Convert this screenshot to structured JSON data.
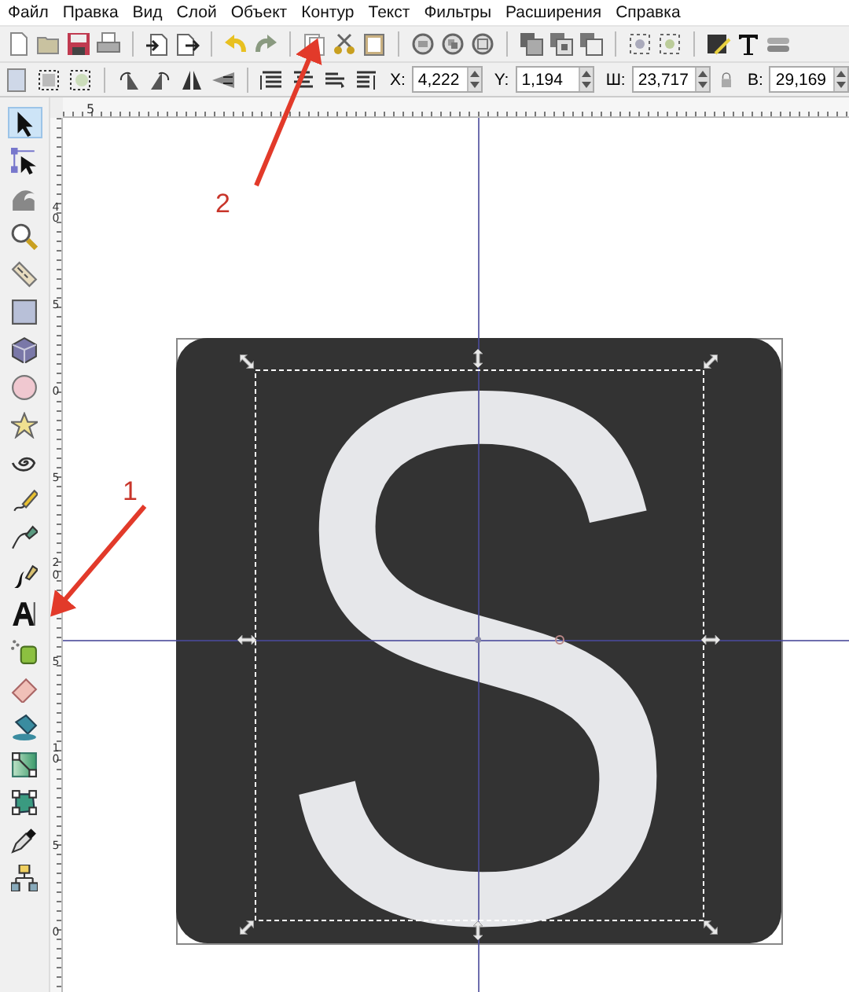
{
  "menu": [
    "Файл",
    "Правка",
    "Вид",
    "Слой",
    "Объект",
    "Контур",
    "Текст",
    "Фильтры",
    "Расширения",
    "Справка"
  ],
  "coordinates": [
    {
      "label": "X:",
      "value": "4,222"
    },
    {
      "label": "Y:",
      "value": "1,194"
    },
    {
      "label": "Ш:",
      "value": "23,717"
    },
    {
      "label": "В:",
      "value": "29,169"
    }
  ],
  "tools": [
    {
      "kind": "select",
      "selected": true
    },
    {
      "kind": "node",
      "selected": false
    },
    {
      "kind": "tweak",
      "selected": false
    },
    {
      "kind": "zoom",
      "selected": false
    },
    {
      "kind": "measure",
      "selected": false
    },
    {
      "kind": "rect",
      "selected": false
    },
    {
      "kind": "box3d",
      "selected": false
    },
    {
      "kind": "ellipse",
      "selected": false
    },
    {
      "kind": "star",
      "selected": false
    },
    {
      "kind": "spiral",
      "selected": false
    },
    {
      "kind": "pencil",
      "selected": false
    },
    {
      "kind": "pen",
      "selected": false
    },
    {
      "kind": "calligraphy",
      "selected": false
    },
    {
      "kind": "text",
      "selected": false
    },
    {
      "kind": "spray",
      "selected": false
    },
    {
      "kind": "eraser",
      "selected": false
    },
    {
      "kind": "bucket",
      "selected": false
    },
    {
      "kind": "gradient",
      "selected": false
    },
    {
      "kind": "mesh",
      "selected": false
    },
    {
      "kind": "dropper",
      "selected": false
    },
    {
      "kind": "connector",
      "selected": false
    }
  ],
  "ruler": {
    "top_labels": [
      "5"
    ],
    "side_labels": [
      "40",
      "5",
      "0",
      "5",
      "20",
      "5",
      "10",
      "5",
      "0"
    ]
  },
  "canvas": {
    "text": "S"
  },
  "annotations": [
    {
      "label": "1"
    },
    {
      "label": "2"
    }
  ]
}
